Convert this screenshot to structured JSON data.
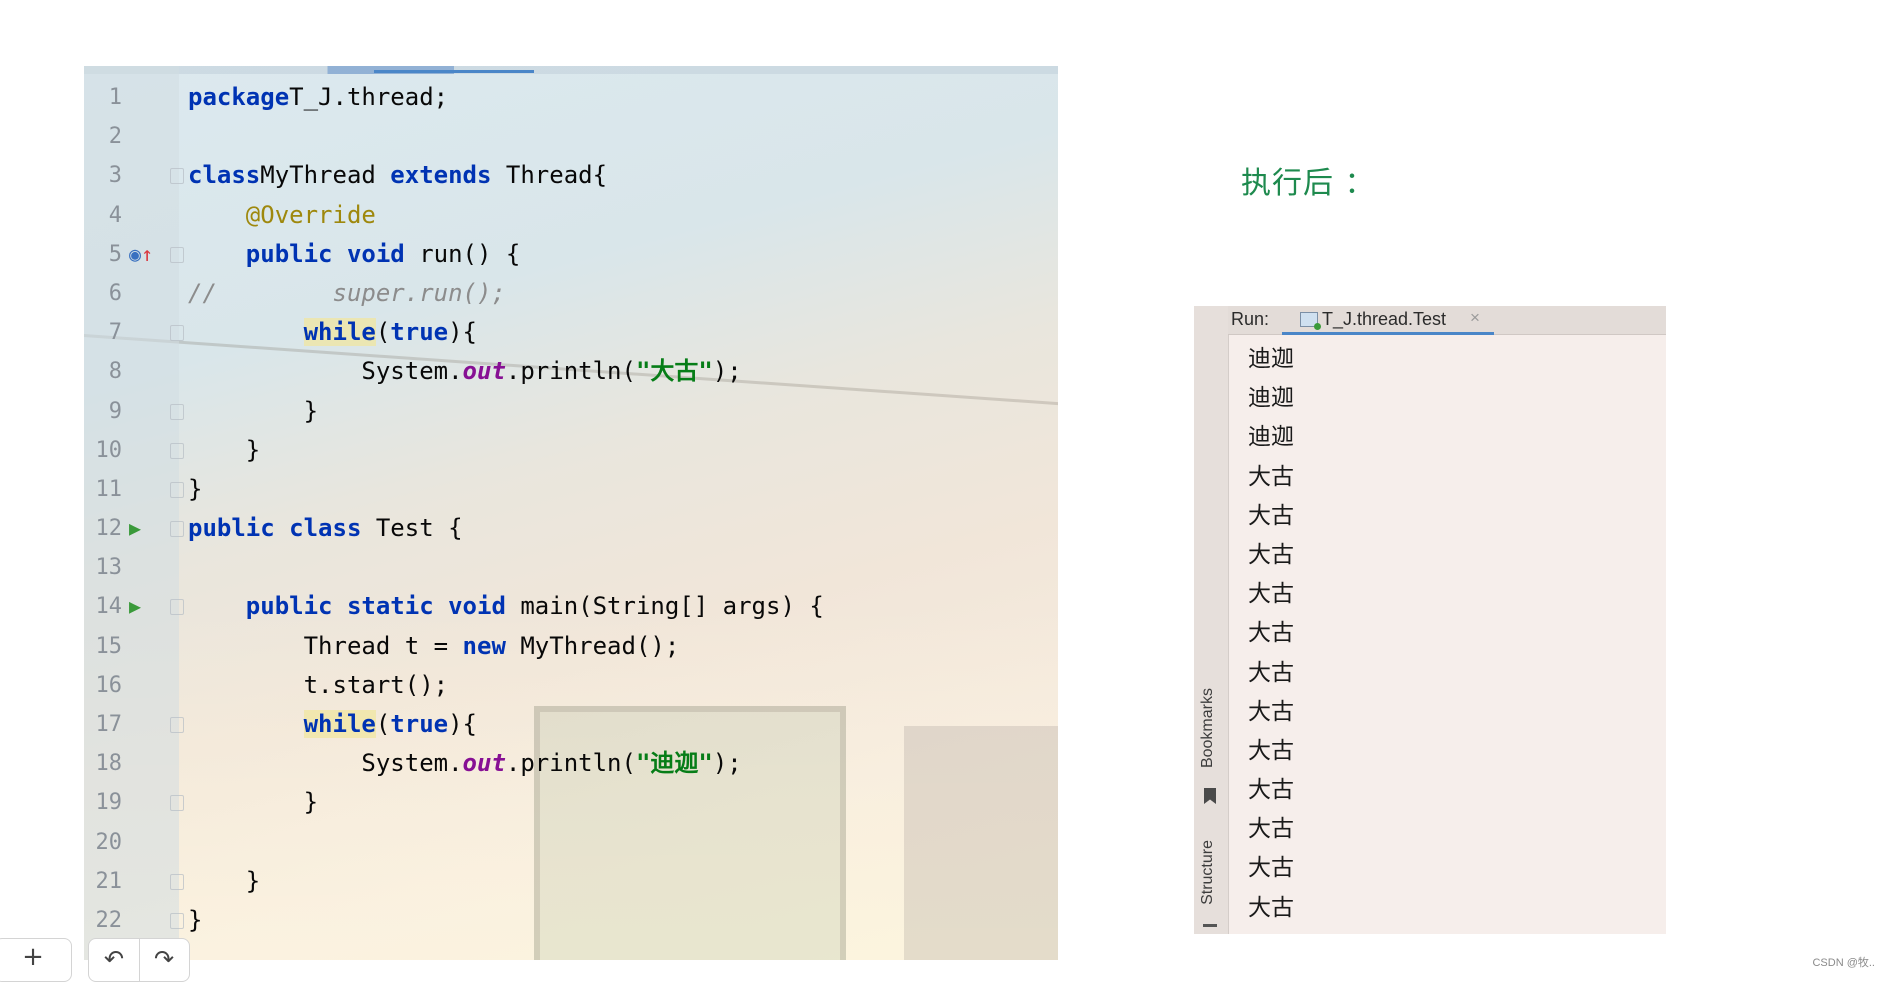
{
  "editor": {
    "lines": [
      {
        "n": "1",
        "segs": [
          [
            "kw",
            "package"
          ],
          [
            "",
            "T_J.thread;"
          ]
        ]
      },
      {
        "n": "2",
        "segs": []
      },
      {
        "n": "3",
        "fold": true,
        "segs": [
          [
            "kw",
            "class"
          ],
          [
            "",
            "MyThread "
          ],
          [
            "kw",
            "extends"
          ],
          [
            "",
            " Thread{"
          ]
        ]
      },
      {
        "n": "4",
        "segs": [
          [
            "",
            "    "
          ],
          [
            "ann",
            "@Override"
          ]
        ]
      },
      {
        "n": "5",
        "mark": "override",
        "fold": true,
        "segs": [
          [
            "",
            "    "
          ],
          [
            "kw",
            "public"
          ],
          [
            "",
            " "
          ],
          [
            "kw",
            "void"
          ],
          [
            "",
            " run() {"
          ]
        ]
      },
      {
        "n": "6",
        "segs": [
          [
            "cm",
            "//        super.run();"
          ]
        ]
      },
      {
        "n": "7",
        "fold": true,
        "segs": [
          [
            "",
            "        "
          ],
          [
            "kw hl",
            "while"
          ],
          [
            "",
            "("
          ],
          [
            "kw",
            "true"
          ],
          [
            "",
            "){"
          ]
        ]
      },
      {
        "n": "8",
        "segs": [
          [
            "",
            "            System."
          ],
          [
            "fld",
            "out"
          ],
          [
            "",
            ".println("
          ],
          [
            "st",
            "\"大古\""
          ],
          [
            "",
            ");"
          ]
        ]
      },
      {
        "n": "9",
        "fold": true,
        "segs": [
          [
            "",
            "        }"
          ]
        ]
      },
      {
        "n": "10",
        "fold": true,
        "segs": [
          [
            "",
            "    }"
          ]
        ]
      },
      {
        "n": "11",
        "fold": true,
        "segs": [
          [
            "",
            "}"
          ]
        ]
      },
      {
        "n": "12",
        "mark": "run",
        "fold": true,
        "segs": [
          [
            "kw",
            "public"
          ],
          [
            "",
            " "
          ],
          [
            "kw",
            "class"
          ],
          [
            "",
            " Test {"
          ]
        ]
      },
      {
        "n": "13",
        "segs": []
      },
      {
        "n": "14",
        "mark": "run",
        "fold": true,
        "segs": [
          [
            "",
            "    "
          ],
          [
            "kw",
            "public"
          ],
          [
            "",
            " "
          ],
          [
            "kw",
            "static"
          ],
          [
            "",
            " "
          ],
          [
            "kw",
            "void"
          ],
          [
            "",
            " main(String[] args) {"
          ]
        ]
      },
      {
        "n": "15",
        "segs": [
          [
            "",
            "        Thread t = "
          ],
          [
            "kw",
            "new"
          ],
          [
            "",
            " MyThread();"
          ]
        ]
      },
      {
        "n": "16",
        "segs": [
          [
            "",
            "        t.start();"
          ]
        ]
      },
      {
        "n": "17",
        "fold": true,
        "segs": [
          [
            "",
            "        "
          ],
          [
            "kw hl",
            "while"
          ],
          [
            "",
            "("
          ],
          [
            "kw",
            "true"
          ],
          [
            "",
            "){"
          ]
        ]
      },
      {
        "n": "18",
        "segs": [
          [
            "",
            "            System."
          ],
          [
            "fld",
            "out"
          ],
          [
            "",
            ".println("
          ],
          [
            "st",
            "\"迪迦\""
          ],
          [
            "",
            ");"
          ]
        ]
      },
      {
        "n": "19",
        "fold": true,
        "segs": [
          [
            "",
            "        }"
          ]
        ]
      },
      {
        "n": "20",
        "segs": []
      },
      {
        "n": "21",
        "fold": true,
        "segs": [
          [
            "",
            "    }"
          ]
        ]
      },
      {
        "n": "22",
        "fold": true,
        "segs": [
          [
            "",
            "}"
          ]
        ]
      }
    ],
    "icons": {
      "run": "run-arrow-icon",
      "override": "override-method-icon"
    }
  },
  "note": "执行后 ：",
  "run_panel": {
    "label": "Run:",
    "tab_title": "T_J.thread.Test",
    "tab_close": "×",
    "side_tabs": {
      "bookmarks": "Bookmarks",
      "structure": "Structure"
    },
    "output": [
      "迪迦",
      "迪迦",
      "迪迦",
      "大古",
      "大古",
      "大古",
      "大古",
      "大古",
      "大古",
      "大古",
      "大古",
      "大古",
      "大古",
      "大古",
      "大古"
    ]
  },
  "controls": {
    "add": "+",
    "undo": "↶",
    "redo": "↷"
  },
  "watermark": "CSDN @牧.."
}
